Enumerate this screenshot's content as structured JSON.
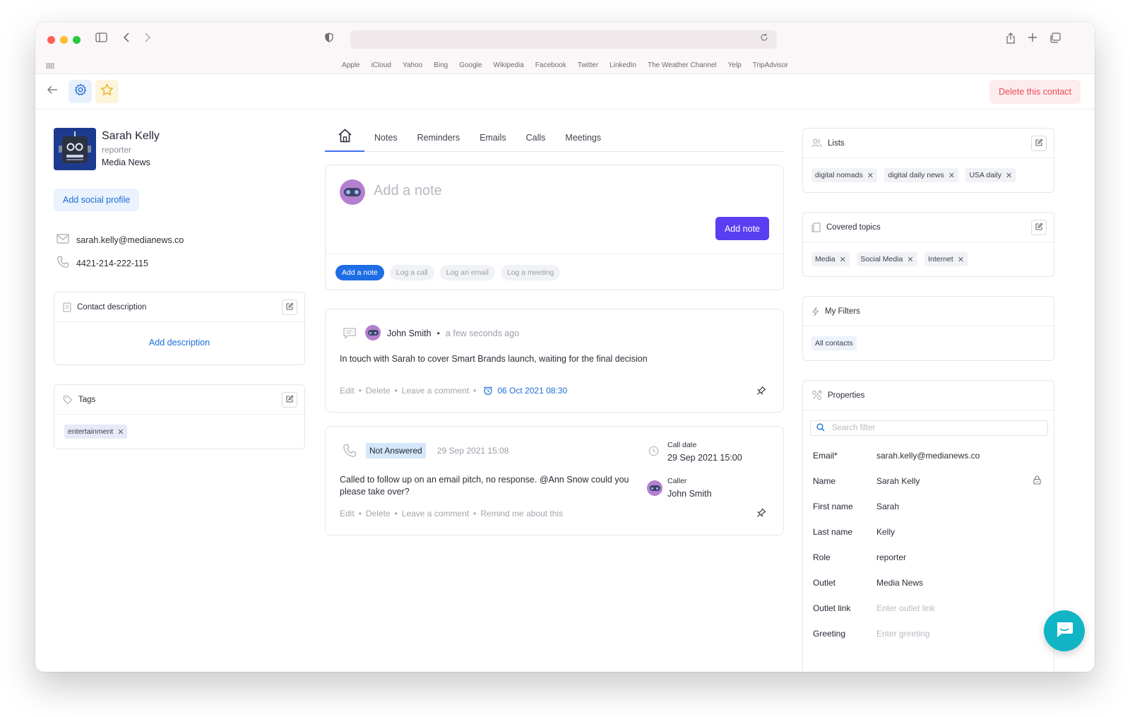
{
  "browser": {
    "favorites": [
      "Apple",
      "iCloud",
      "Yahoo",
      "Bing",
      "Google",
      "Wikipedia",
      "Facebook",
      "Twitter",
      "LinkedIn",
      "The Weather Channel",
      "Yelp",
      "TripAdvisor"
    ]
  },
  "toolbar": {
    "delete_label": "Delete this contact"
  },
  "contact": {
    "name": "Sarah Kelly",
    "role": "reporter",
    "outlet": "Media News",
    "add_social_label": "Add social profile",
    "email": "sarah.kelly@medianews.co",
    "phone": "4421-214-222-115"
  },
  "description_card": {
    "title": "Contact description",
    "add_label": "Add description"
  },
  "tags_card": {
    "title": "Tags",
    "tags": [
      "entertainment"
    ]
  },
  "tabs": [
    "Notes",
    "Reminders",
    "Emails",
    "Calls",
    "Meetings"
  ],
  "note_composer": {
    "placeholder": "Add a note",
    "submit_label": "Add note",
    "actions": [
      "Add a note",
      "Log a call",
      "Log an email",
      "Log a meeting"
    ]
  },
  "activity_note": {
    "author": "John Smith",
    "time": "a few seconds ago",
    "body": "In touch with Sarah to cover Smart Brands launch, waiting for the final decision",
    "actions": [
      "Edit",
      "Delete",
      "Leave a comment"
    ],
    "reminder": "06 Oct 2021 08:30"
  },
  "activity_call": {
    "status": "Not Answered",
    "datetime": "29 Sep 2021 15:08",
    "body_before": "Called to follow up on an email pitch, no response.",
    "mention": "@Ann Snow",
    "body_after": "could you please take over?",
    "call_date_label": "Call date",
    "call_date": "29 Sep 2021 15:00",
    "caller_label": "Caller",
    "caller": "John Smith",
    "actions": [
      "Edit",
      "Delete",
      "Leave a comment",
      "Remind me about this"
    ]
  },
  "lists_card": {
    "title": "Lists",
    "items": [
      "digital nomads",
      "digital daily news",
      "USA daily"
    ]
  },
  "topics_card": {
    "title": "Covered topics",
    "items": [
      "Media",
      "Social Media",
      "Internet"
    ]
  },
  "filters_card": {
    "title": "My Filters",
    "items": [
      "All contacts"
    ]
  },
  "properties_card": {
    "title": "Properties",
    "search_placeholder": "Search filter",
    "rows": [
      {
        "key": "Email*",
        "value": "sarah.kelly@medianews.co",
        "placeholder": false
      },
      {
        "key": "Name",
        "value": "Sarah Kelly",
        "placeholder": false
      },
      {
        "key": "First name",
        "value": "Sarah",
        "placeholder": false
      },
      {
        "key": "Last name",
        "value": "Kelly",
        "placeholder": false
      },
      {
        "key": "Role",
        "value": "reporter",
        "placeholder": false
      },
      {
        "key": "Outlet",
        "value": "Media News",
        "placeholder": false
      },
      {
        "key": "Outlet link",
        "value": "Enter outlet link",
        "placeholder": true
      },
      {
        "key": "Greeting",
        "value": "Enter greeting",
        "placeholder": true
      }
    ]
  },
  "colors": {
    "primary": "#5a3ef2",
    "link": "#1a6dd6",
    "danger": "#ec4a57",
    "chat": "#11b5c5"
  }
}
